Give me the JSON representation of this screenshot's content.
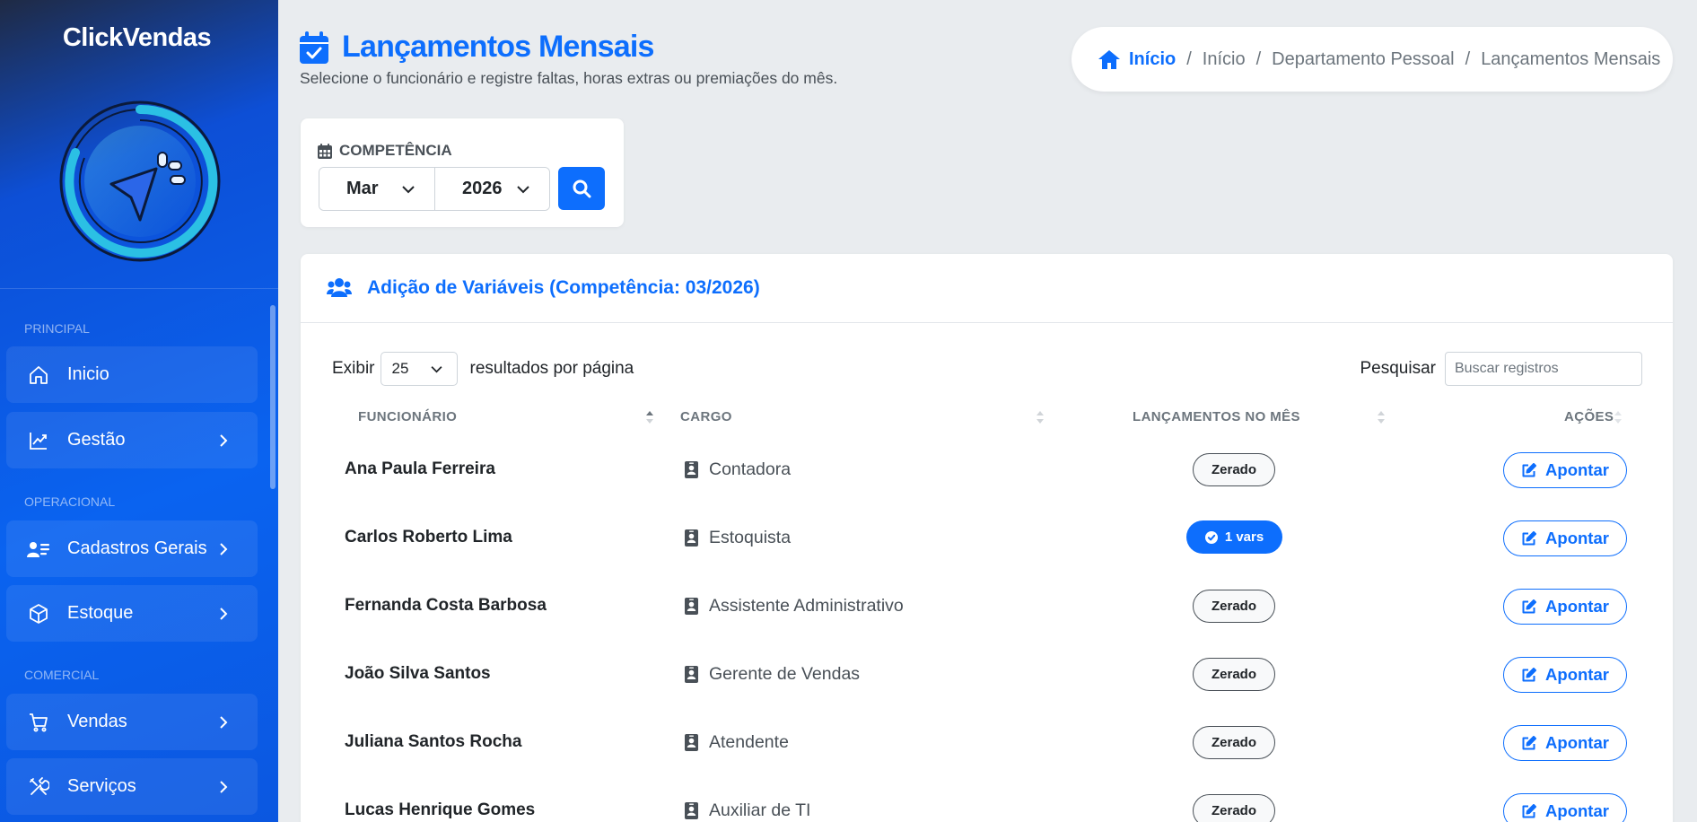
{
  "brand": {
    "name": "ClickVendas"
  },
  "sidebar": {
    "sections": {
      "principal": "PRINCIPAL",
      "operacional": "OPERACIONAL",
      "comercial": "COMERCIAL"
    },
    "items": [
      {
        "label": "Inicio",
        "icon": "home-icon",
        "has_children": false
      },
      {
        "label": "Gestão",
        "icon": "chart-line-icon",
        "has_children": true
      },
      {
        "label": "Cadastros Gerais",
        "icon": "id-card-icon",
        "has_children": true
      },
      {
        "label": "Estoque",
        "icon": "box-icon",
        "has_children": true
      },
      {
        "label": "Vendas",
        "icon": "cart-icon",
        "has_children": true
      },
      {
        "label": "Serviços",
        "icon": "tools-icon",
        "has_children": true
      }
    ]
  },
  "header": {
    "title": "Lançamentos Mensais",
    "subtitle": "Selecione o funcionário e registre faltas, horas extras ou premiações do mês."
  },
  "breadcrumb": {
    "home": "Início",
    "items": [
      "Início",
      "Departamento Pessoal",
      "Lançamentos Mensais"
    ]
  },
  "competencia": {
    "label": "COMPETÊNCIA",
    "month": "Mar",
    "year": "2026"
  },
  "table_card": {
    "title": "Adição de Variáveis (Competência: 03/2026)",
    "length": {
      "prefix": "Exibir",
      "value": "25",
      "suffix": "resultados por página"
    },
    "search": {
      "label": "Pesquisar",
      "placeholder": "Buscar registros"
    },
    "columns": [
      "FUNCIONÁRIO",
      "CARGO",
      "LANÇAMENTOS NO MÊS",
      "AÇÕES"
    ],
    "action_label": "Apontar",
    "rows": [
      {
        "name": "Ana Paula Ferreira",
        "cargo": "Contadora",
        "status": "Zerado",
        "has_vars": false
      },
      {
        "name": "Carlos Roberto Lima",
        "cargo": "Estoquista",
        "status": "1 vars",
        "has_vars": true
      },
      {
        "name": "Fernanda Costa Barbosa",
        "cargo": "Assistente Administrativo",
        "status": "Zerado",
        "has_vars": false
      },
      {
        "name": "João Silva Santos",
        "cargo": "Gerente de Vendas",
        "status": "Zerado",
        "has_vars": false
      },
      {
        "name": "Juliana Santos Rocha",
        "cargo": "Atendente",
        "status": "Zerado",
        "has_vars": false
      },
      {
        "name": "Lucas Henrique Gomes",
        "cargo": "Auxiliar de TI",
        "status": "Zerado",
        "has_vars": false
      }
    ]
  },
  "colors": {
    "primary": "#0d6efd",
    "sidebar_start": "#1f2a44",
    "sidebar_end": "#0b57e0",
    "background": "#e9ecef"
  }
}
